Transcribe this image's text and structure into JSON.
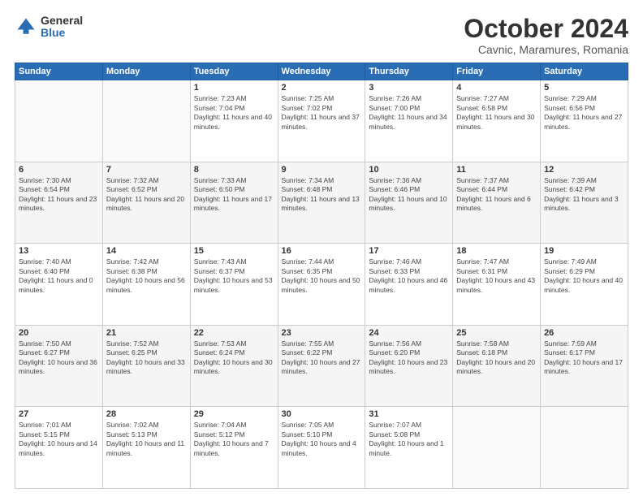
{
  "logo": {
    "general": "General",
    "blue": "Blue"
  },
  "title": {
    "month": "October 2024",
    "location": "Cavnic, Maramures, Romania"
  },
  "headers": [
    "Sunday",
    "Monday",
    "Tuesday",
    "Wednesday",
    "Thursday",
    "Friday",
    "Saturday"
  ],
  "weeks": [
    [
      {
        "day": "",
        "info": ""
      },
      {
        "day": "",
        "info": ""
      },
      {
        "day": "1",
        "info": "Sunrise: 7:23 AM\nSunset: 7:04 PM\nDaylight: 11 hours and 40 minutes."
      },
      {
        "day": "2",
        "info": "Sunrise: 7:25 AM\nSunset: 7:02 PM\nDaylight: 11 hours and 37 minutes."
      },
      {
        "day": "3",
        "info": "Sunrise: 7:26 AM\nSunset: 7:00 PM\nDaylight: 11 hours and 34 minutes."
      },
      {
        "day": "4",
        "info": "Sunrise: 7:27 AM\nSunset: 6:58 PM\nDaylight: 11 hours and 30 minutes."
      },
      {
        "day": "5",
        "info": "Sunrise: 7:29 AM\nSunset: 6:56 PM\nDaylight: 11 hours and 27 minutes."
      }
    ],
    [
      {
        "day": "6",
        "info": "Sunrise: 7:30 AM\nSunset: 6:54 PM\nDaylight: 11 hours and 23 minutes."
      },
      {
        "day": "7",
        "info": "Sunrise: 7:32 AM\nSunset: 6:52 PM\nDaylight: 11 hours and 20 minutes."
      },
      {
        "day": "8",
        "info": "Sunrise: 7:33 AM\nSunset: 6:50 PM\nDaylight: 11 hours and 17 minutes."
      },
      {
        "day": "9",
        "info": "Sunrise: 7:34 AM\nSunset: 6:48 PM\nDaylight: 11 hours and 13 minutes."
      },
      {
        "day": "10",
        "info": "Sunrise: 7:36 AM\nSunset: 6:46 PM\nDaylight: 11 hours and 10 minutes."
      },
      {
        "day": "11",
        "info": "Sunrise: 7:37 AM\nSunset: 6:44 PM\nDaylight: 11 hours and 6 minutes."
      },
      {
        "day": "12",
        "info": "Sunrise: 7:39 AM\nSunset: 6:42 PM\nDaylight: 11 hours and 3 minutes."
      }
    ],
    [
      {
        "day": "13",
        "info": "Sunrise: 7:40 AM\nSunset: 6:40 PM\nDaylight: 11 hours and 0 minutes."
      },
      {
        "day": "14",
        "info": "Sunrise: 7:42 AM\nSunset: 6:38 PM\nDaylight: 10 hours and 56 minutes."
      },
      {
        "day": "15",
        "info": "Sunrise: 7:43 AM\nSunset: 6:37 PM\nDaylight: 10 hours and 53 minutes."
      },
      {
        "day": "16",
        "info": "Sunrise: 7:44 AM\nSunset: 6:35 PM\nDaylight: 10 hours and 50 minutes."
      },
      {
        "day": "17",
        "info": "Sunrise: 7:46 AM\nSunset: 6:33 PM\nDaylight: 10 hours and 46 minutes."
      },
      {
        "day": "18",
        "info": "Sunrise: 7:47 AM\nSunset: 6:31 PM\nDaylight: 10 hours and 43 minutes."
      },
      {
        "day": "19",
        "info": "Sunrise: 7:49 AM\nSunset: 6:29 PM\nDaylight: 10 hours and 40 minutes."
      }
    ],
    [
      {
        "day": "20",
        "info": "Sunrise: 7:50 AM\nSunset: 6:27 PM\nDaylight: 10 hours and 36 minutes."
      },
      {
        "day": "21",
        "info": "Sunrise: 7:52 AM\nSunset: 6:25 PM\nDaylight: 10 hours and 33 minutes."
      },
      {
        "day": "22",
        "info": "Sunrise: 7:53 AM\nSunset: 6:24 PM\nDaylight: 10 hours and 30 minutes."
      },
      {
        "day": "23",
        "info": "Sunrise: 7:55 AM\nSunset: 6:22 PM\nDaylight: 10 hours and 27 minutes."
      },
      {
        "day": "24",
        "info": "Sunrise: 7:56 AM\nSunset: 6:20 PM\nDaylight: 10 hours and 23 minutes."
      },
      {
        "day": "25",
        "info": "Sunrise: 7:58 AM\nSunset: 6:18 PM\nDaylight: 10 hours and 20 minutes."
      },
      {
        "day": "26",
        "info": "Sunrise: 7:59 AM\nSunset: 6:17 PM\nDaylight: 10 hours and 17 minutes."
      }
    ],
    [
      {
        "day": "27",
        "info": "Sunrise: 7:01 AM\nSunset: 5:15 PM\nDaylight: 10 hours and 14 minutes."
      },
      {
        "day": "28",
        "info": "Sunrise: 7:02 AM\nSunset: 5:13 PM\nDaylight: 10 hours and 11 minutes."
      },
      {
        "day": "29",
        "info": "Sunrise: 7:04 AM\nSunset: 5:12 PM\nDaylight: 10 hours and 7 minutes."
      },
      {
        "day": "30",
        "info": "Sunrise: 7:05 AM\nSunset: 5:10 PM\nDaylight: 10 hours and 4 minutes."
      },
      {
        "day": "31",
        "info": "Sunrise: 7:07 AM\nSunset: 5:08 PM\nDaylight: 10 hours and 1 minute."
      },
      {
        "day": "",
        "info": ""
      },
      {
        "day": "",
        "info": ""
      }
    ]
  ]
}
